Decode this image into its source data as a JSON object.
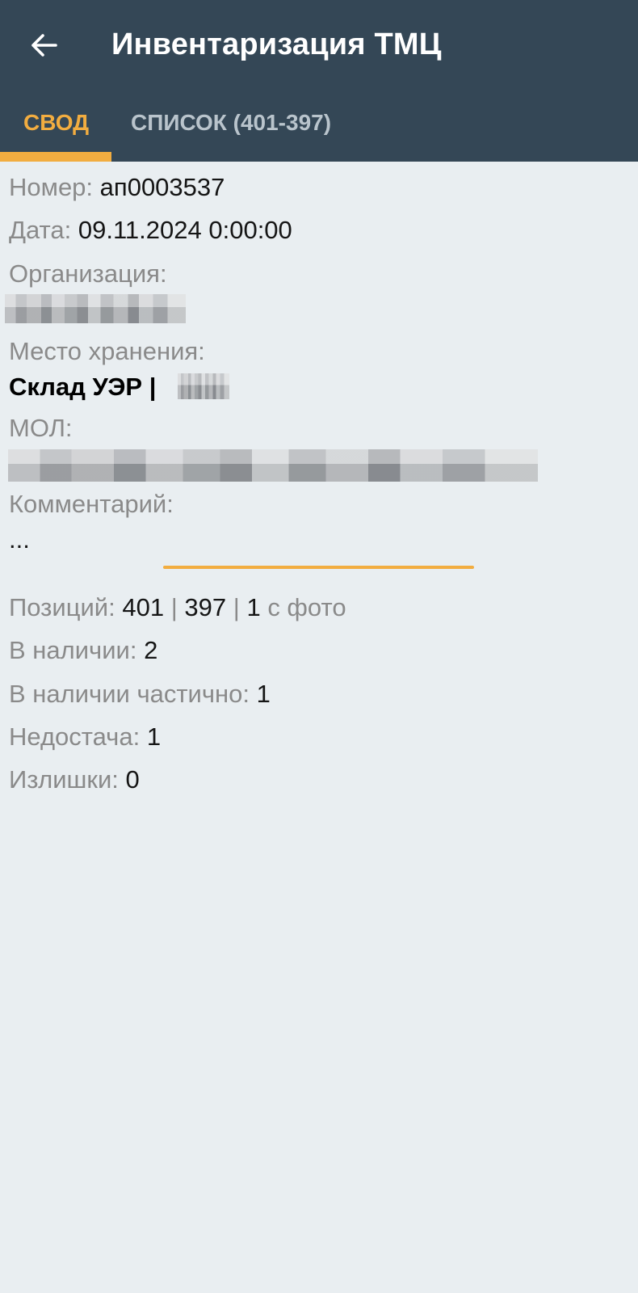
{
  "header": {
    "back_icon": "arrow-left-icon",
    "title": "Инвентаризация ТМЦ",
    "tabs": [
      {
        "label": "СВОД",
        "active": true
      },
      {
        "label": "СПИСОК (401-397)",
        "active": false
      }
    ],
    "accent_color": "#f2ad40",
    "bar_color": "#344756"
  },
  "summary": {
    "number_label": "Номер:",
    "number_value": "ап0003537",
    "date_label": "Дата:",
    "date_value": "09.11.2024 0:00:00",
    "org_label": "Организация:",
    "storage_label": "Место хранения:",
    "storage_value": "Склад УЭР |",
    "mol_label": "МОЛ:",
    "comment_label": "Комментарий:",
    "comment_value": "..."
  },
  "stats": {
    "positions_label": "Позиций:",
    "positions_total": "401",
    "sep": "|",
    "positions_checked": "397",
    "photos_count": "1",
    "photos_suffix": "с фото",
    "in_stock_label": "В наличии:",
    "in_stock_value": "2",
    "partial_label": "В наличии частично:",
    "partial_value": "1",
    "shortage_label": "Недостача:",
    "shortage_value": "1",
    "surplus_label": "Излишки:",
    "surplus_value": "0"
  }
}
